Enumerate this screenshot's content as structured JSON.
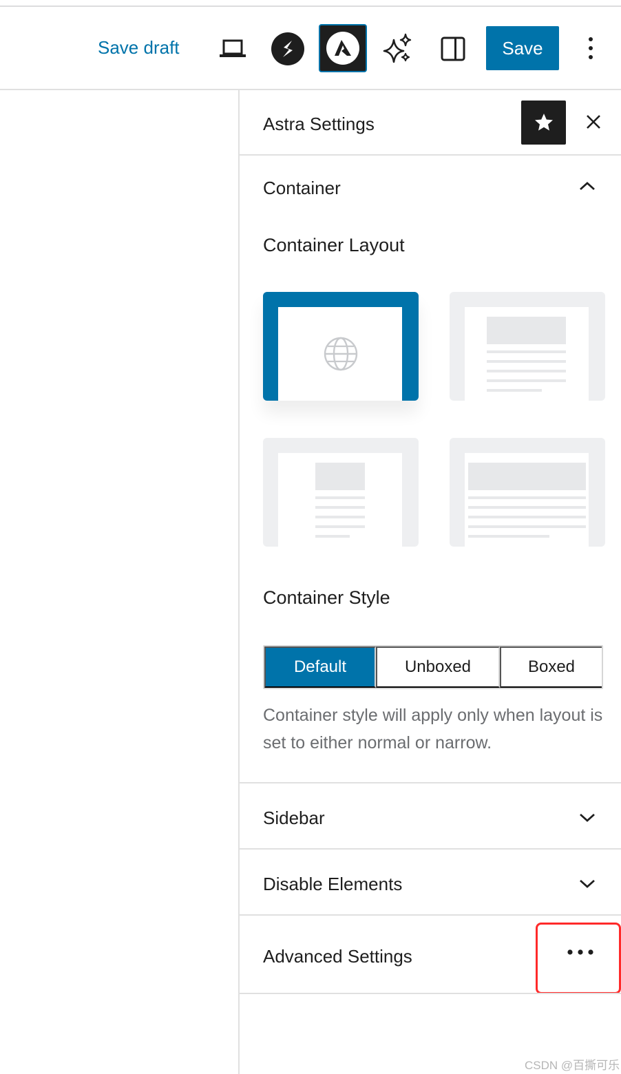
{
  "toolbar": {
    "save_draft_label": "Save draft",
    "save_label": "Save",
    "icons": [
      "laptop-preview-icon",
      "spectra-icon",
      "astra-icon",
      "sparkle-icon",
      "sidebar-toggle-icon",
      "more-vertical-icon"
    ]
  },
  "panel": {
    "title": "Astra Settings",
    "star_icon": "star-icon",
    "close_icon": "close-icon"
  },
  "container": {
    "section_title": "Container",
    "layout_title": "Container Layout",
    "layout_options": [
      "default-layout",
      "normal-layout",
      "narrow-layout",
      "full-width-layout"
    ],
    "selected_layout": "default-layout",
    "style_title": "Container Style",
    "style_options": [
      "Default",
      "Unboxed",
      "Boxed"
    ],
    "selected_style": "Default",
    "help_text": "Container style will apply only when layout is set to either normal or narrow."
  },
  "sections": {
    "sidebar_title": "Sidebar",
    "disable_elements_title": "Disable Elements",
    "advanced_title": "Advanced Settings"
  },
  "colors": {
    "accent": "#0073aa",
    "highlight": "#ff2a2a"
  },
  "watermark": "CSDN @百撕可乐"
}
